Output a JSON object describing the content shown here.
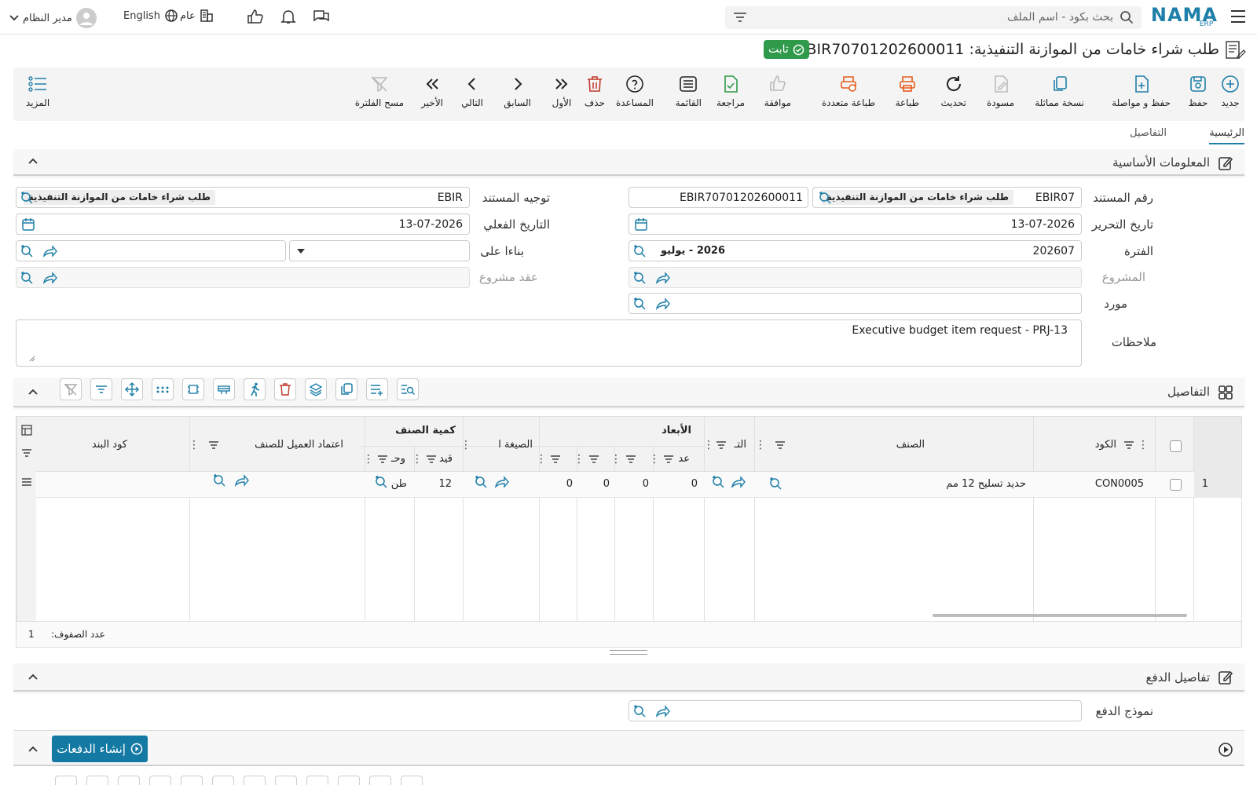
{
  "topbar": {
    "logo": "NAMA",
    "logo_sub": "ERP",
    "search_placeholder": "بحث بكود - اسم الملف",
    "branch": "عام",
    "language": "English",
    "user": "مدير النظام"
  },
  "title": {
    "text": "طلب شراء خامات من الموازنة التنفيذية: EBIR70701202600011",
    "status": "ثابت"
  },
  "toolbar": {
    "new": "جديد",
    "save": "حفظ",
    "save_continue": "حفظ و مواصلة",
    "duplicate": "نسخة مماثلة",
    "draft": "مسودة",
    "refresh": "تحديث",
    "print": "طباعة",
    "multi_print": "طباعة متعددة",
    "approve": "موافقة",
    "review": "مراجعة",
    "list": "القائمة",
    "help": "المساعدة",
    "delete": "حذف",
    "first": "الأول",
    "previous": "السابق",
    "next": "التالي",
    "last": "الأخير",
    "clear_filter": "مسح الفلترة",
    "more": "المزيد"
  },
  "tabs": {
    "main": "الرئيسية",
    "details": "التفاصيل"
  },
  "basic_info": {
    "section_title": "المعلومات الأساسية",
    "doc_number_label": "رقم المستند",
    "doc_number_code": "EBIR07",
    "doc_number_name": "طلب شراء خامات من الموازنة التنفيذية",
    "doc_number_value": "EBIR70701202600011",
    "doc_direction_label": "توجيه المستند",
    "doc_direction_code": "EBIR",
    "doc_direction_name": "طلب شراء خامات من الموازنة التنفيذية",
    "edit_date_label": "تاريخ التحرير",
    "edit_date": "13-07-2026",
    "actual_date_label": "التاريخ الفعلي",
    "actual_date": "13-07-2026",
    "period_label": "الفترة",
    "period_code": "202607",
    "period_name": "2026 - يوليو",
    "based_on_label": "بناءا على",
    "project_label": "المشروع",
    "project_contract_label": "عقد مشروع",
    "supplier_label": "مورد",
    "notes_label": "ملاحظات",
    "notes": "Executive budget item request - PRJ-13"
  },
  "details": {
    "section_title": "التفاصيل",
    "columns": {
      "code": "الكود",
      "item": "الصنف",
      "group_dimensions": "الأبعاد",
      "dim_short": "التـ",
      "count": "عد",
      "group_item_qty": "كمية الصنف",
      "formula": "الصيغة ا",
      "qty": "قيد",
      "unit": "وحـ",
      "customer_approval": "اعتماد العميل للصنف",
      "line_code": "كود البند"
    },
    "rows": [
      {
        "num": "1",
        "code": "CON0005",
        "item": "حديد تسليح 12 مم",
        "count": "0",
        "d2": "0",
        "d3": "0",
        "d4": "0",
        "qty": "12",
        "unit": "طن"
      }
    ],
    "row_count_label": "عدد الصفوف:",
    "row_count": "1"
  },
  "payment": {
    "section_title": "تفاصيل الدفع",
    "payment_form_label": "نموذج الدفع",
    "create_payments": "إنشاء الدفعات"
  }
}
